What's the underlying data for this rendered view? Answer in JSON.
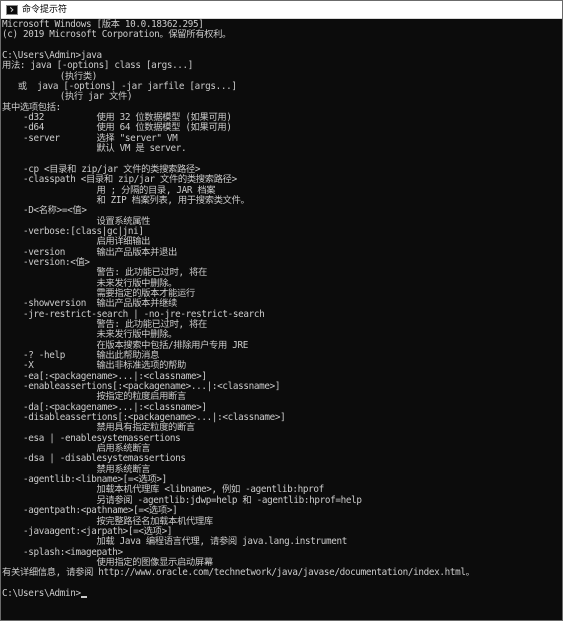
{
  "window": {
    "title": "命令提示符"
  },
  "console": {
    "lines": [
      "Microsoft Windows [版本 10.0.18362.295]",
      "(c) 2019 Microsoft Corporation。保留所有权利。",
      "",
      "C:\\Users\\Admin>java",
      "用法: java [-options] class [args...]",
      "           (执行类)",
      "   或  java [-options] -jar jarfile [args...]",
      "           (执行 jar 文件)",
      "其中选项包括:",
      "    -d32          使用 32 位数据模型 (如果可用)",
      "    -d64          使用 64 位数据模型 (如果可用)",
      "    -server       选择 \"server\" VM",
      "                  默认 VM 是 server.",
      "",
      "    -cp <目录和 zip/jar 文件的类搜索路径>",
      "    -classpath <目录和 zip/jar 文件的类搜索路径>",
      "                  用 ; 分隔的目录, JAR 档案",
      "                  和 ZIP 档案列表, 用于搜索类文件。",
      "    -D<名称>=<值>",
      "                  设置系统属性",
      "    -verbose:[class|gc|jni]",
      "                  启用详细输出",
      "    -version      输出产品版本并退出",
      "    -version:<值>",
      "                  警告: 此功能已过时, 将在",
      "                  未来发行版中删除。",
      "                  需要指定的版本才能运行",
      "    -showversion  输出产品版本并继续",
      "    -jre-restrict-search | -no-jre-restrict-search",
      "                  警告: 此功能已过时, 将在",
      "                  未来发行版中删除。",
      "                  在版本搜索中包括/排除用户专用 JRE",
      "    -? -help      输出此帮助消息",
      "    -X            输出非标准选项的帮助",
      "    -ea[:<packagename>...|:<classname>]",
      "    -enableassertions[:<packagename>...|:<classname>]",
      "                  按指定的粒度启用断言",
      "    -da[:<packagename>...|:<classname>]",
      "    -disableassertions[:<packagename>...|:<classname>]",
      "                  禁用具有指定粒度的断言",
      "    -esa | -enablesystemassertions",
      "                  启用系统断言",
      "    -dsa | -disablesystemassertions",
      "                  禁用系统断言",
      "    -agentlib:<libname>[=<选项>]",
      "                  加载本机代理库 <libname>, 例如 -agentlib:hprof",
      "                  另请参阅 -agentlib:jdwp=help 和 -agentlib:hprof=help",
      "    -agentpath:<pathname>[=<选项>]",
      "                  按完整路径名加载本机代理库",
      "    -javaagent:<jarpath>[=<选项>]",
      "                  加载 Java 编程语言代理, 请参阅 java.lang.instrument",
      "    -splash:<imagepath>",
      "                  使用指定的图像显示启动屏幕",
      "有关详细信息, 请参阅 http://www.oracle.com/technetwork/java/javase/documentation/index.html。",
      ""
    ],
    "prompt": "C:\\Users\\Admin>"
  },
  "icons": {
    "app": "cmd-icon"
  },
  "colors": {
    "background": "#0c0c0c",
    "text": "#cccccc",
    "titlebar": "#ffffff"
  }
}
